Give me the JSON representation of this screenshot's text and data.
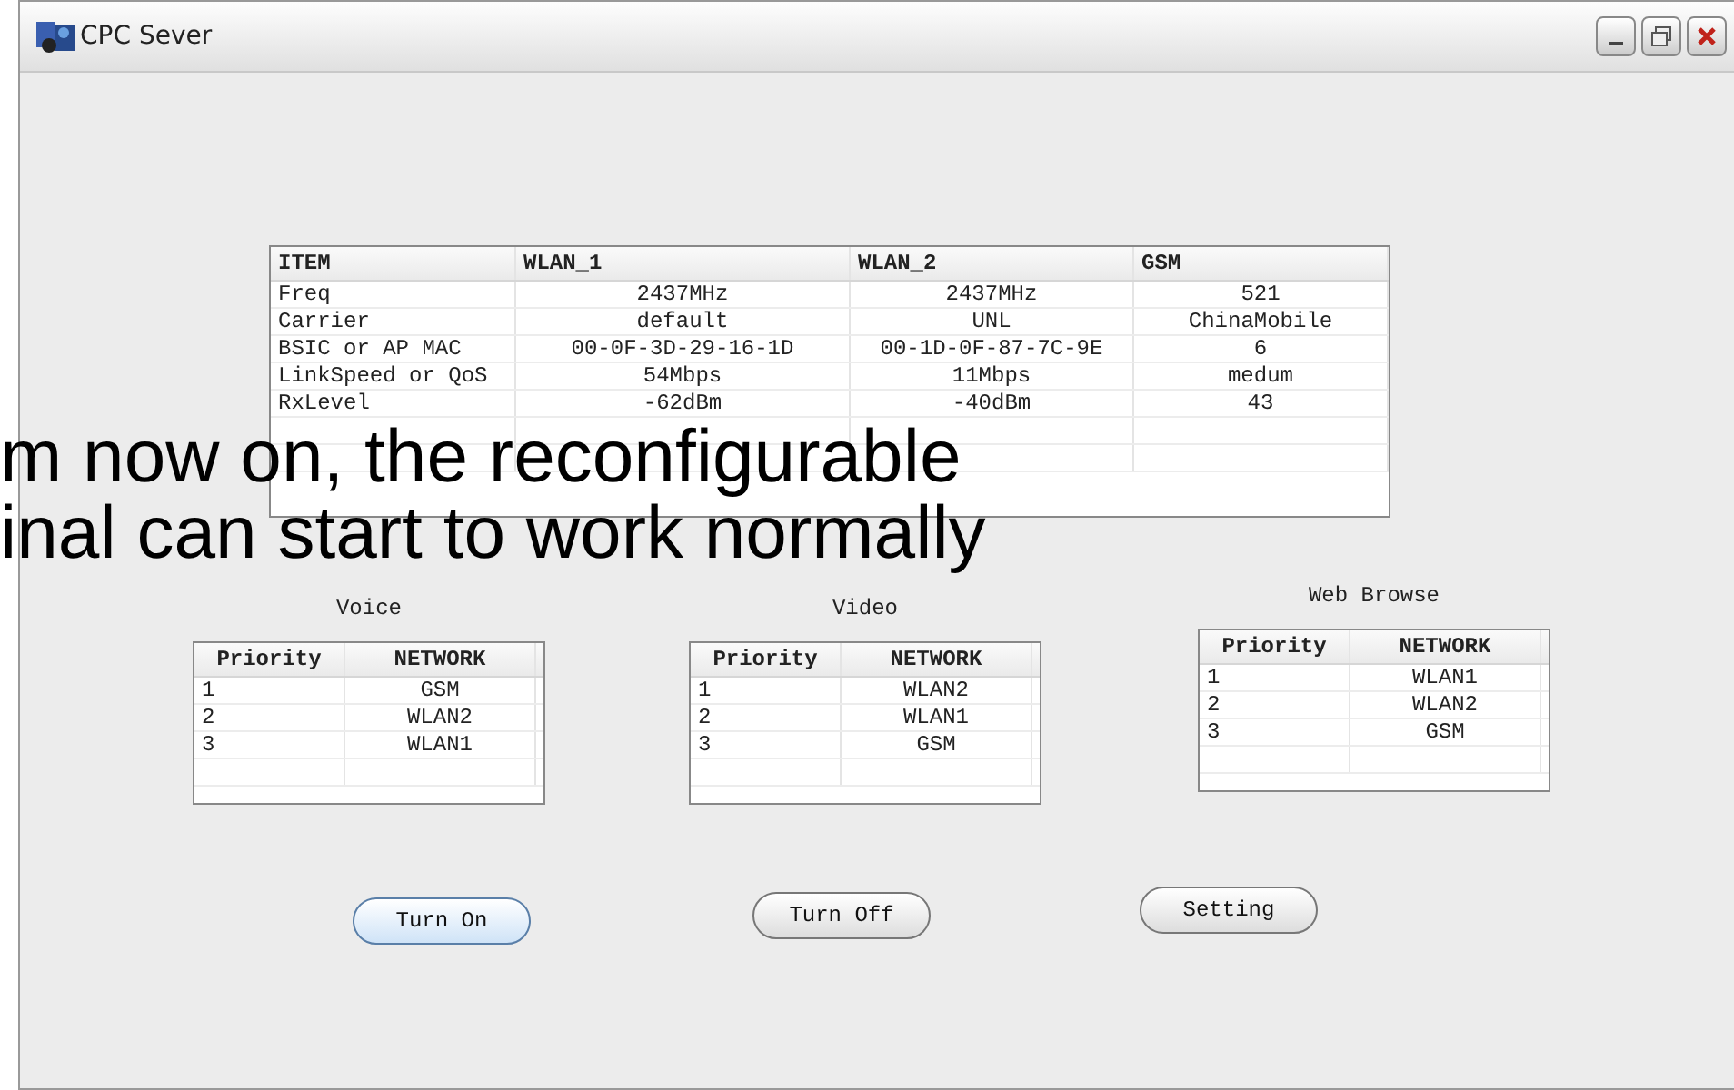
{
  "window": {
    "title": "CPC Sever"
  },
  "status_table": {
    "columns": [
      "ITEM",
      "WLAN_1",
      "WLAN_2",
      "GSM"
    ],
    "rows": [
      [
        "Freq",
        "2437MHz",
        "2437MHz",
        "521"
      ],
      [
        "Carrier",
        "default",
        "UNL",
        "ChinaMobile"
      ],
      [
        "BSIC or AP MAC",
        "00-0F-3D-29-16-1D",
        "00-1D-0F-87-7C-9E",
        "6"
      ],
      [
        "LinkSpeed or QoS",
        "54Mbps",
        "11Mbps",
        "medum"
      ],
      [
        "RxLevel",
        "-62dBm",
        "-40dBm",
        "43"
      ]
    ]
  },
  "priority_tables": [
    {
      "title": "Voice",
      "columns": [
        "Priority",
        "NETWORK"
      ],
      "rows": [
        [
          "1",
          "GSM"
        ],
        [
          "2",
          "WLAN2"
        ],
        [
          "3",
          "WLAN1"
        ]
      ]
    },
    {
      "title": "Video",
      "columns": [
        "Priority",
        "NETWORK"
      ],
      "rows": [
        [
          "1",
          "WLAN2"
        ],
        [
          "2",
          "WLAN1"
        ],
        [
          "3",
          "GSM"
        ]
      ]
    },
    {
      "title": "Web Browse",
      "columns": [
        "Priority",
        "NETWORK"
      ],
      "rows": [
        [
          "1",
          "WLAN1"
        ],
        [
          "2",
          "WLAN2"
        ],
        [
          "3",
          "GSM"
        ]
      ]
    }
  ],
  "buttons": [
    {
      "label": "Turn On",
      "focused": true
    },
    {
      "label": "Turn Off",
      "focused": false
    },
    {
      "label": "Setting",
      "focused": false
    }
  ],
  "overlay_text": [
    "m now on, the reconfigurable",
    "inal can start to work normally"
  ]
}
